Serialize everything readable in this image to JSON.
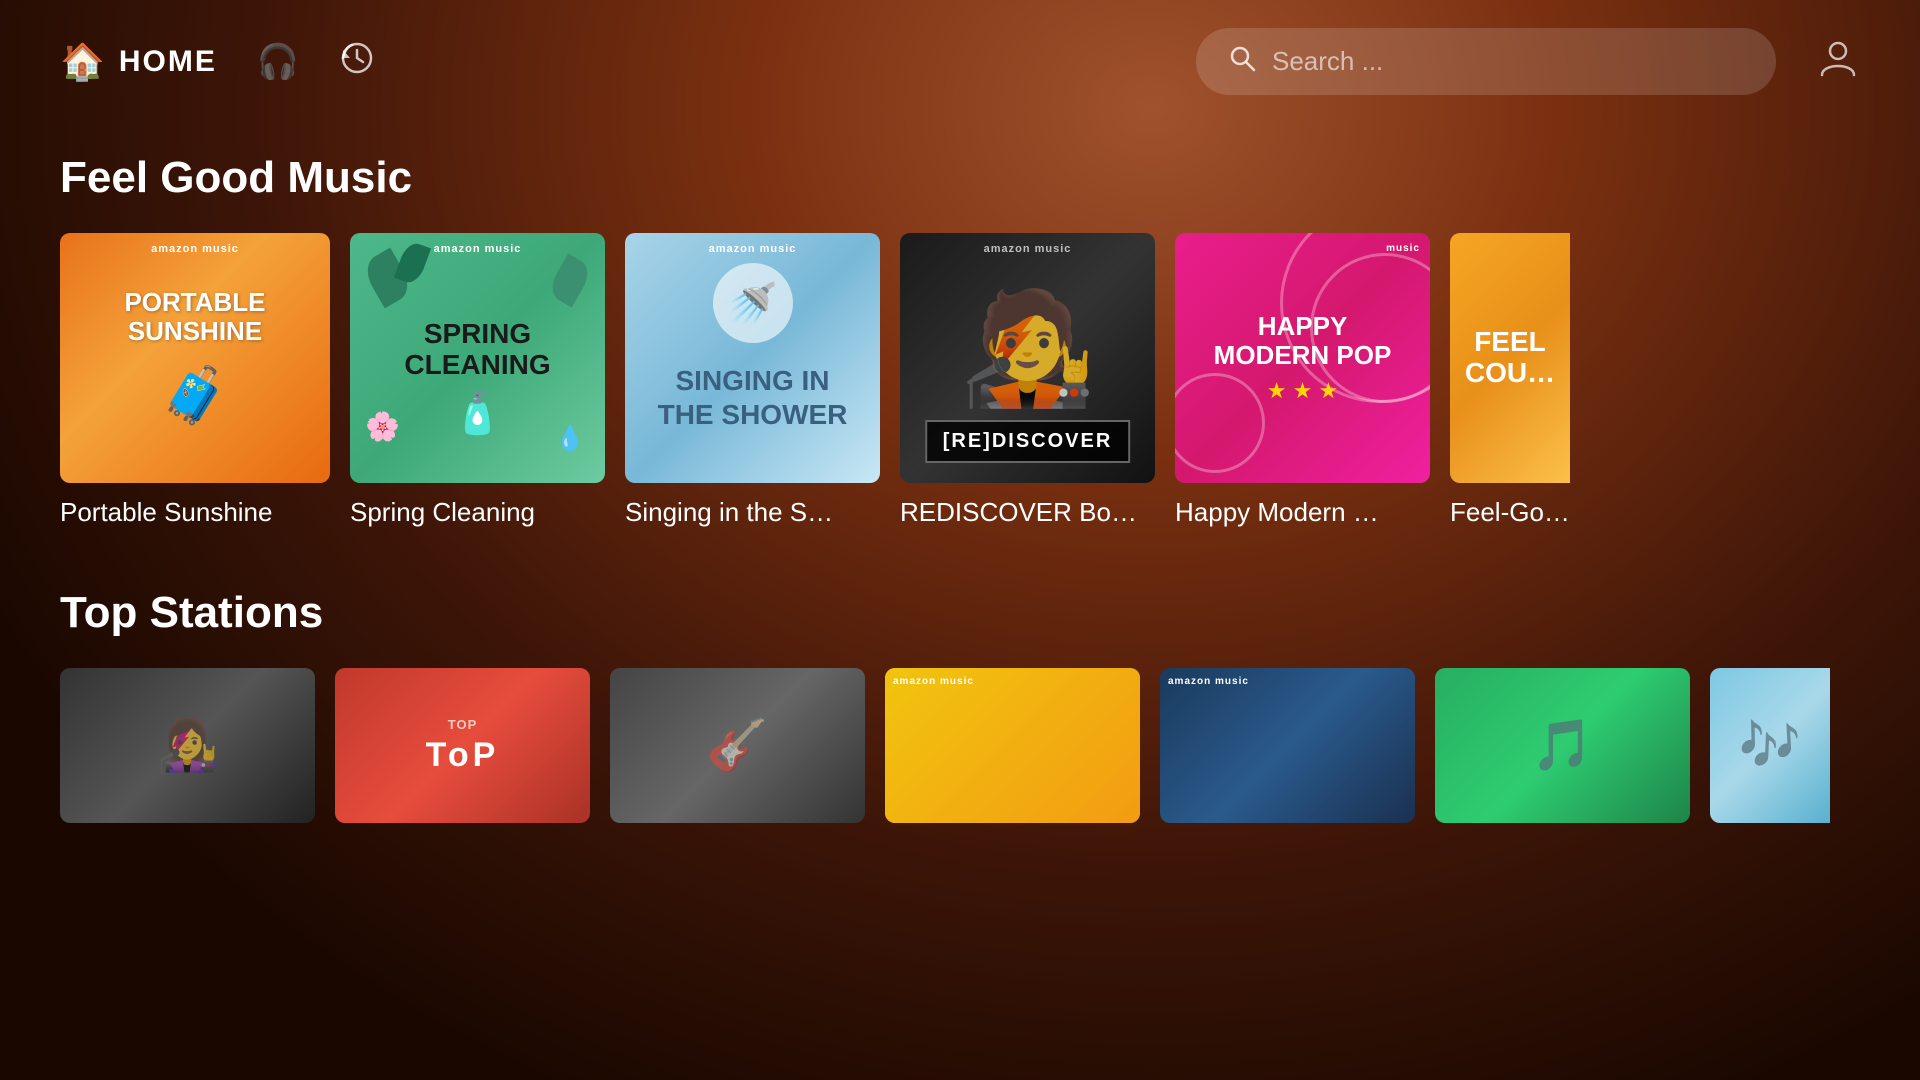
{
  "header": {
    "home_label": "HOME",
    "search_placeholder": "Search ...",
    "nav_items": [
      {
        "id": "home",
        "icon": "🏠",
        "label": "HOME"
      },
      {
        "id": "headphones",
        "icon": "🎧",
        "label": "Headphones"
      },
      {
        "id": "history",
        "icon": "⏱",
        "label": "History"
      }
    ]
  },
  "sections": [
    {
      "id": "feel-good-music",
      "title": "Feel Good Music",
      "cards": [
        {
          "id": "portable-sunshine",
          "label": "Portable Sunshine",
          "artwork_type": "portable-sunshine",
          "artwork_text_line1": "PORTABLE",
          "artwork_text_line2": "SUNSHINE",
          "badge": "amazon music"
        },
        {
          "id": "spring-cleaning",
          "label": "Spring Cleaning",
          "artwork_type": "spring-cleaning",
          "artwork_text_line1": "SPRING",
          "artwork_text_line2": "CLEANING",
          "badge": "amazon music"
        },
        {
          "id": "singing-shower",
          "label": "Singing in the S…",
          "artwork_type": "singing-shower",
          "artwork_text_line1": "SINGING IN",
          "artwork_text_line2": "THE SHOWER",
          "badge": "amazon music"
        },
        {
          "id": "rediscover",
          "label": "REDISCOVER Bo…",
          "artwork_type": "rediscover",
          "artwork_text": "[RE]DISCOVER",
          "badge": "amazon music"
        },
        {
          "id": "happy-modern-pop",
          "label": "Happy Modern …",
          "artwork_type": "happy-modern-pop",
          "artwork_text_line1": "HAPPY",
          "artwork_text_line2": "MODERN POP",
          "stars": "★ ★ ★",
          "badge": "music"
        },
        {
          "id": "feel-good-country",
          "label": "Feel-Go…",
          "artwork_type": "feel-good",
          "artwork_text_line1": "FEEL",
          "artwork_text_line2": "COU…",
          "badge": ""
        }
      ]
    },
    {
      "id": "top-stations",
      "title": "Top Stations",
      "cards": [
        {
          "id": "station-bw",
          "artwork_type": "bw-portrait"
        },
        {
          "id": "station-top",
          "artwork_type": "top-red",
          "text": "ToP"
        },
        {
          "id": "station-dark",
          "artwork_type": "dark-portrait"
        },
        {
          "id": "station-yellow",
          "artwork_type": "yellow"
        },
        {
          "id": "station-amazon-blue",
          "artwork_type": "amazon-blue"
        },
        {
          "id": "station-green",
          "artwork_type": "green"
        },
        {
          "id": "station-light-blue",
          "artwork_type": "light-blue"
        }
      ]
    }
  ]
}
